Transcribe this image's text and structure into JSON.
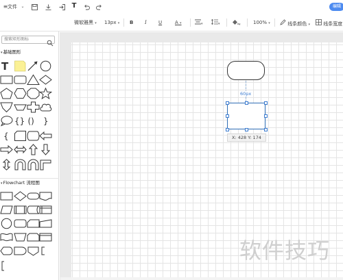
{
  "topbar": {
    "file_menu": "文件",
    "edit_button": "编辑"
  },
  "format_toolbar": {
    "font_family": "微软雅黑",
    "font_size": "13px",
    "bold": "B",
    "italic": "I",
    "underline": "U",
    "font_color": "A",
    "zoom": "100%",
    "line_color": "线条颜色",
    "line_width": "线条宽度"
  },
  "sidebar": {
    "search_placeholder": "搜索矩形图标",
    "sections": [
      {
        "title": "基础图形"
      },
      {
        "title": "Flowchart 流程图"
      }
    ]
  },
  "canvas": {
    "distance_label": "60px",
    "coord_tip": "X: 428  Y: 174",
    "watermark": "软件技巧"
  },
  "colors": {
    "accent": "#4d8bf0",
    "selection": "#2d6db5",
    "canvas_bg": "#e9e9e9"
  }
}
